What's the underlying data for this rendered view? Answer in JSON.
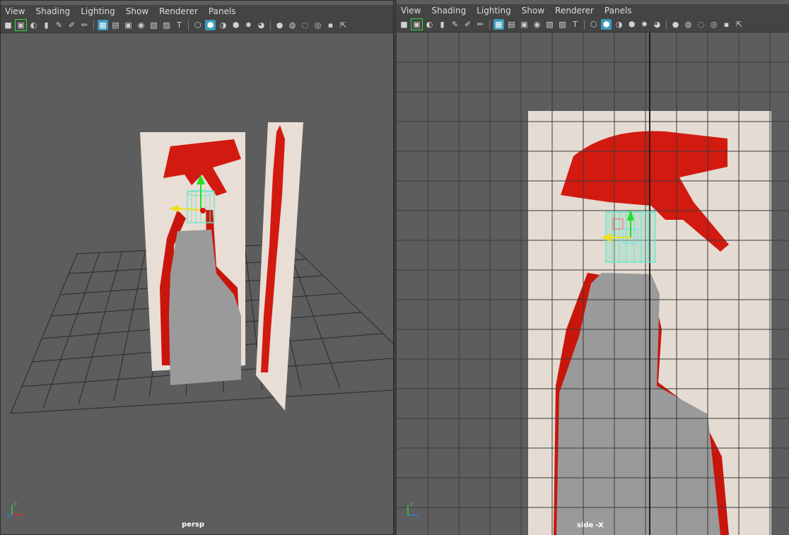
{
  "left_panel": {
    "menu": [
      "View",
      "Shading",
      "Lighting",
      "Show",
      "Renderer",
      "Panels"
    ],
    "camera_label": "persp"
  },
  "right_panel": {
    "menu": [
      "View",
      "Shading",
      "Lighting",
      "Show",
      "Renderer",
      "Panels"
    ],
    "camera_label": "side -X"
  },
  "toolbar_icons": [
    "select-camera-icon",
    "camera-attributes-icon",
    "bookmark-icon",
    "image-plane-icon",
    "two-d-pan-icon",
    "grease-pencil-icon",
    "grid-icon",
    "film-gate-icon",
    "resolution-gate-icon",
    "gate-mask-icon",
    "field-chart-icon",
    "safe-action-icon",
    "safe-title-icon",
    "wireframe-icon",
    "smooth-shade-icon",
    "lighting-icon",
    "textured-icon",
    "use-lights-icon",
    "shadows-icon",
    "screen-space-ao-icon",
    "motion-blur-icon",
    "anti-aliasing-icon",
    "depth-of-field-icon",
    "isolate-select-icon",
    "xray-icon"
  ],
  "colors": {
    "bottle_red": "#d21a10",
    "bottle_gray": "#9a9a9a",
    "manipulator_cyan": "#6fe6c8",
    "viewport_bg": "#5d5d5d",
    "accent_blue": "#3d9bbd"
  }
}
